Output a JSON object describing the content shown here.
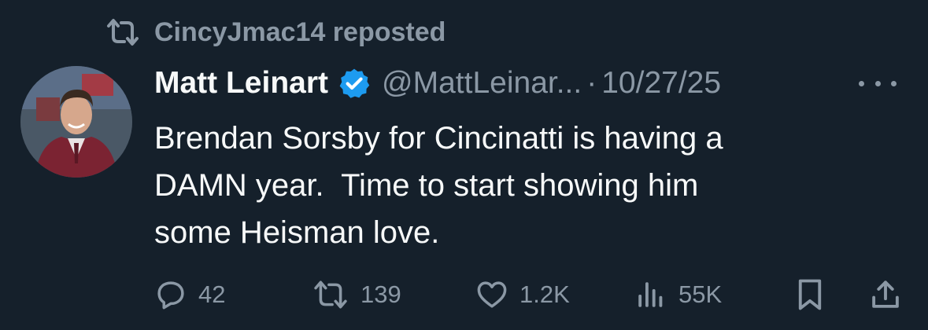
{
  "repost": {
    "text": "CincyJmac14 reposted",
    "icon": "repost-icon"
  },
  "author": {
    "display_name": "Matt Leinart",
    "handle": "@MattLeinar...",
    "separator": "·",
    "date": "10/27/25",
    "verified_color": "#1d9bf0"
  },
  "tweet": {
    "lines": [
      "Brendan Sorsby for Cincinatti is having a",
      "DAMN year.  Time to start showing him",
      "some Heisman love."
    ]
  },
  "actions": {
    "replies": "42",
    "reposts": "139",
    "likes": "1.2K",
    "views": "55K"
  },
  "colors": {
    "background": "#15202b",
    "muted": "#8b98a5",
    "text": "#f7f9f9"
  }
}
